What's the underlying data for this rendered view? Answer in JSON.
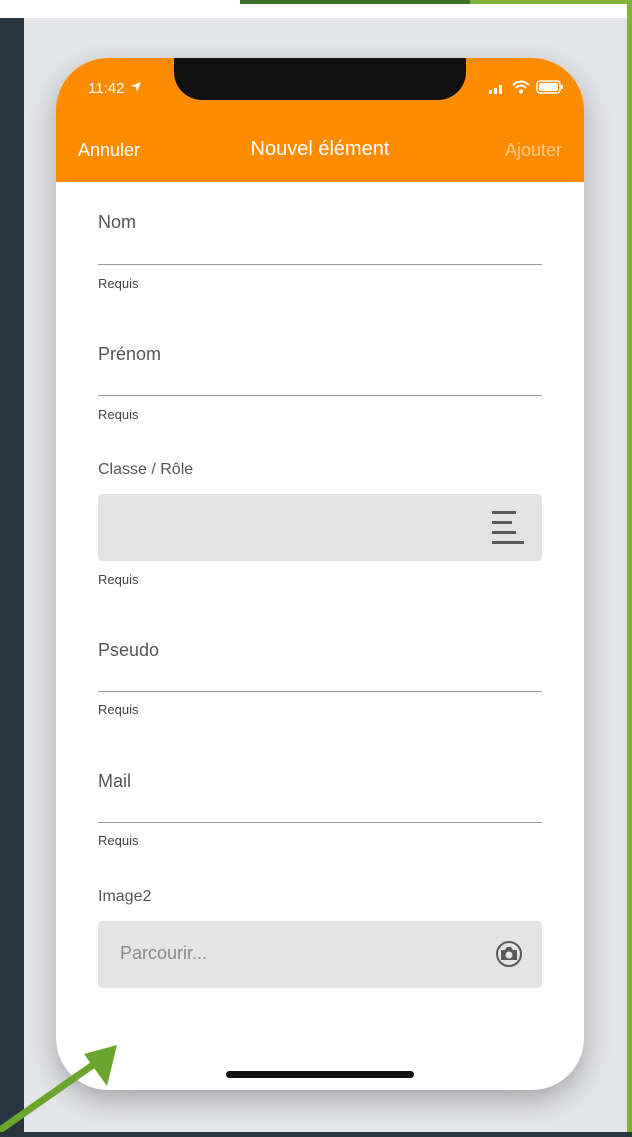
{
  "status": {
    "time": "11:42"
  },
  "nav": {
    "cancel": "Annuler",
    "title": "Nouvel élément",
    "add": "Ajouter"
  },
  "form": {
    "nom": {
      "placeholder": "Nom",
      "hint": "Requis"
    },
    "prenom": {
      "placeholder": "Prénom",
      "hint": "Requis"
    },
    "classe": {
      "label": "Classe / Rôle",
      "hint": "Requis"
    },
    "pseudo": {
      "placeholder": "Pseudo",
      "hint": "Requis"
    },
    "mail": {
      "placeholder": "Mail",
      "hint": "Requis"
    },
    "image": {
      "label": "Image2",
      "placeholder": "Parcourir..."
    }
  },
  "icons": {
    "location": "location-arrow-icon",
    "signal": "signal-icon",
    "wifi": "wifi-icon",
    "battery": "battery-icon",
    "menu": "menu-lines-icon",
    "camera": "camera-icon",
    "arrow": "green-arrow-icon"
  },
  "colors": {
    "header": "#ff8c00",
    "accent_green": "#7fb23a",
    "background": "#26353f"
  }
}
